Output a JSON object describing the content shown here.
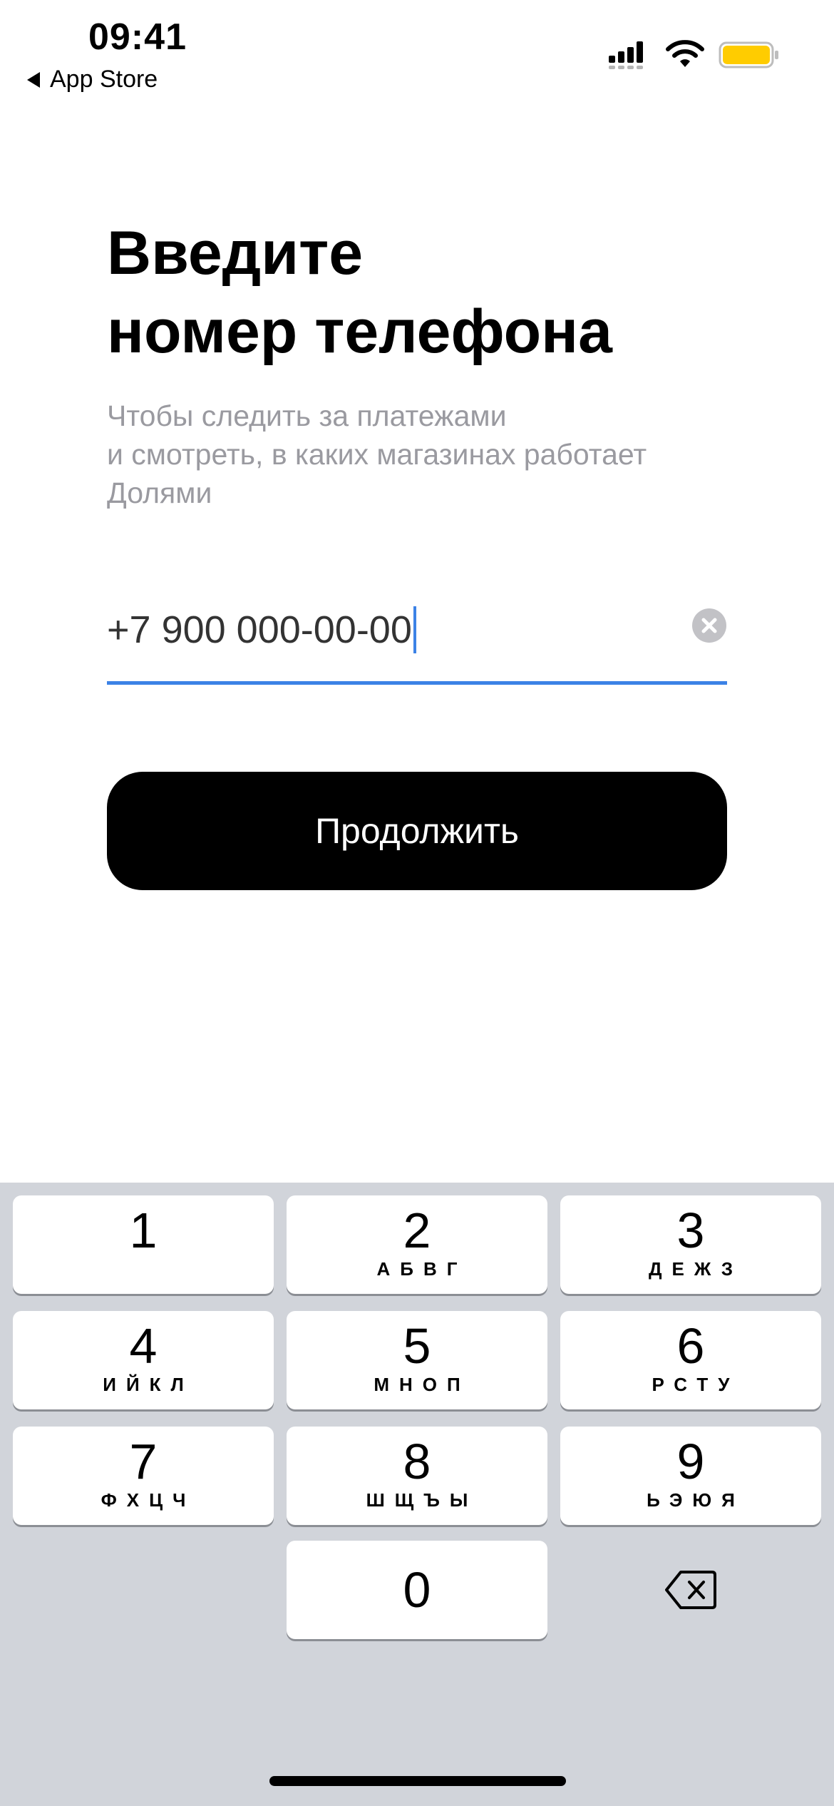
{
  "status_bar": {
    "time": "09:41",
    "back_app": "App Store",
    "icons": [
      "cellular-signal-icon",
      "wifi-icon",
      "battery-icon"
    ],
    "battery_color": "#ffcc00"
  },
  "header": {
    "title_line1": "Введите",
    "title_line2": "номер телефона",
    "subtitle_line1": "Чтобы следить за платежами",
    "subtitle_line2": "и смотреть, в каких магазинах работает",
    "subtitle_line3": "Долями"
  },
  "phone_input": {
    "value": "+7 900 000-00-00",
    "accent_color": "#3c82e6"
  },
  "continue_button": {
    "label": "Продолжить"
  },
  "keypad": {
    "keys": [
      {
        "digit": "1",
        "letters": ""
      },
      {
        "digit": "2",
        "letters": "АБВГ"
      },
      {
        "digit": "3",
        "letters": "ДЕЖЗ"
      },
      {
        "digit": "4",
        "letters": "ИЙКЛ"
      },
      {
        "digit": "5",
        "letters": "МНОП"
      },
      {
        "digit": "6",
        "letters": "РСТУ"
      },
      {
        "digit": "7",
        "letters": "ФХЦЧ"
      },
      {
        "digit": "8",
        "letters": "ШЩЪЫ"
      },
      {
        "digit": "9",
        "letters": "ЬЭЮЯ"
      },
      {
        "digit": "0",
        "letters": ""
      }
    ],
    "delete_icon": "backspace-icon"
  }
}
